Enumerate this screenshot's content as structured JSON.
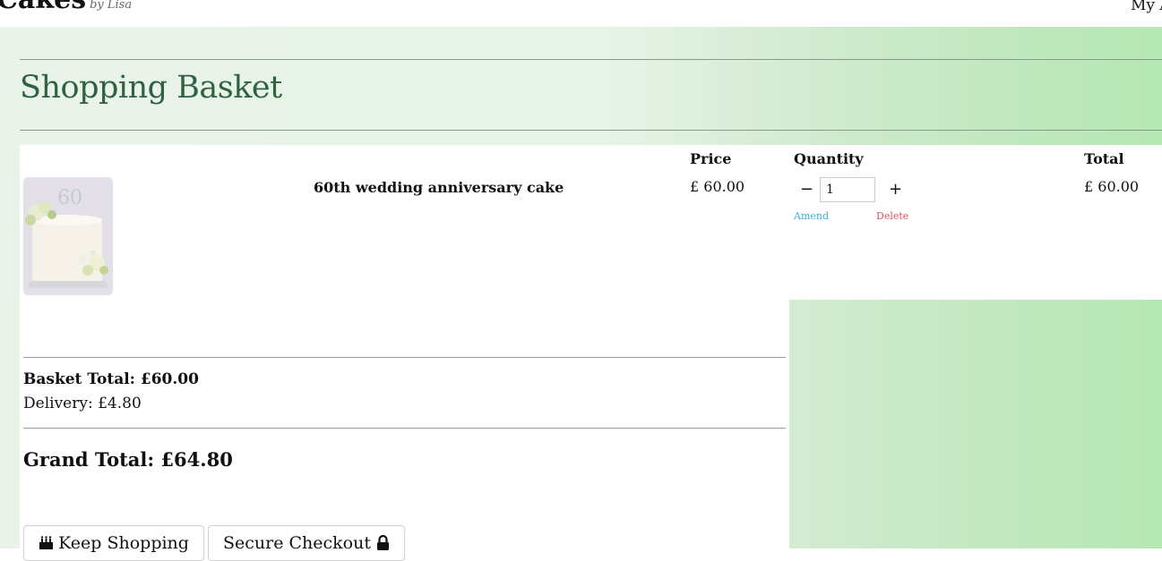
{
  "header": {
    "brand": "Cakes",
    "brand_sub": "by Lisa",
    "account_link": "My A"
  },
  "page": {
    "title": "Shopping Basket"
  },
  "table": {
    "headers": {
      "price": "Price",
      "quantity": "Quantity",
      "total": "Total"
    },
    "items": [
      {
        "name": "60th wedding anniversary cake",
        "price": "£ 60.00",
        "quantity": "1",
        "total": "£ 60.00",
        "amend_label": "Amend",
        "delete_label": "Delete",
        "decrement": "−",
        "increment": "+"
      }
    ]
  },
  "summary": {
    "basket_total": "Basket Total: £60.00",
    "delivery": "Delivery: £4.80",
    "grand_total": "Grand Total: £64.80"
  },
  "buttons": {
    "keep_shopping": "Keep Shopping",
    "secure_checkout": "Secure Checkout"
  },
  "icons": {
    "keep_shopping": "birthday-cake-icon",
    "secure_checkout": "lock-icon"
  },
  "colors": {
    "title": "#2f6340",
    "amend": "#3ab0d6",
    "delete": "#d9534f",
    "gradient_end": "#b5e8b3"
  }
}
